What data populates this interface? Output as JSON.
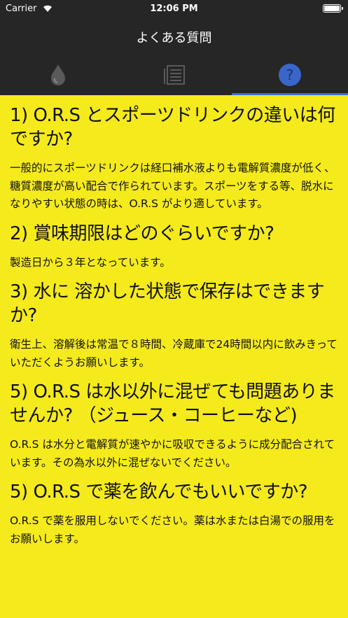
{
  "status": {
    "carrier": "Carrier",
    "time": "12:06 PM"
  },
  "header": {
    "title": "よくある質問"
  },
  "tabs": [
    {
      "icon": "water-drop-icon",
      "active": false
    },
    {
      "icon": "document-list-icon",
      "active": false
    },
    {
      "icon": "question-icon",
      "label": "?",
      "active": true
    }
  ],
  "colors": {
    "bar": "#262626",
    "content_bg": "#f5ea1c",
    "accent": "#3b66c9"
  },
  "faq": [
    {
      "question": "1) O.R.S とスポーツドリンクの違いは何ですか?",
      "answer": "一般的にスポーツドリンクは経口補水液よりも電解質濃度が低く、糖質濃度が高い配合で作られています。スポーツをする等、脱水になりやすい状態の時は、O.R.S がより適しています。"
    },
    {
      "question": "2) 賞味期限はどのぐらいですか?",
      "answer": "製造日から３年となっています。"
    },
    {
      "question": "3) 水に 溶かした状態で保存はできますか?",
      "answer": "衛生上、溶解後は常温で８時間、冷蔵庫で24時間以内に飲みきっていただくようお願いします。"
    },
    {
      "question": "5) O.R.S は水以外に混ぜても問題ありませんか? （ジュース・コーヒーなど)",
      "answer": "O.R.S は水分と電解質が速やかに吸収できるように成分配合されています。その為水以外に混ぜないでください。"
    },
    {
      "question": "5) O.R.S で薬を飲んでもいいですか?",
      "answer": "O.R.S で薬を服用しないでください。薬は水または白湯での服用をお願いします。"
    }
  ]
}
